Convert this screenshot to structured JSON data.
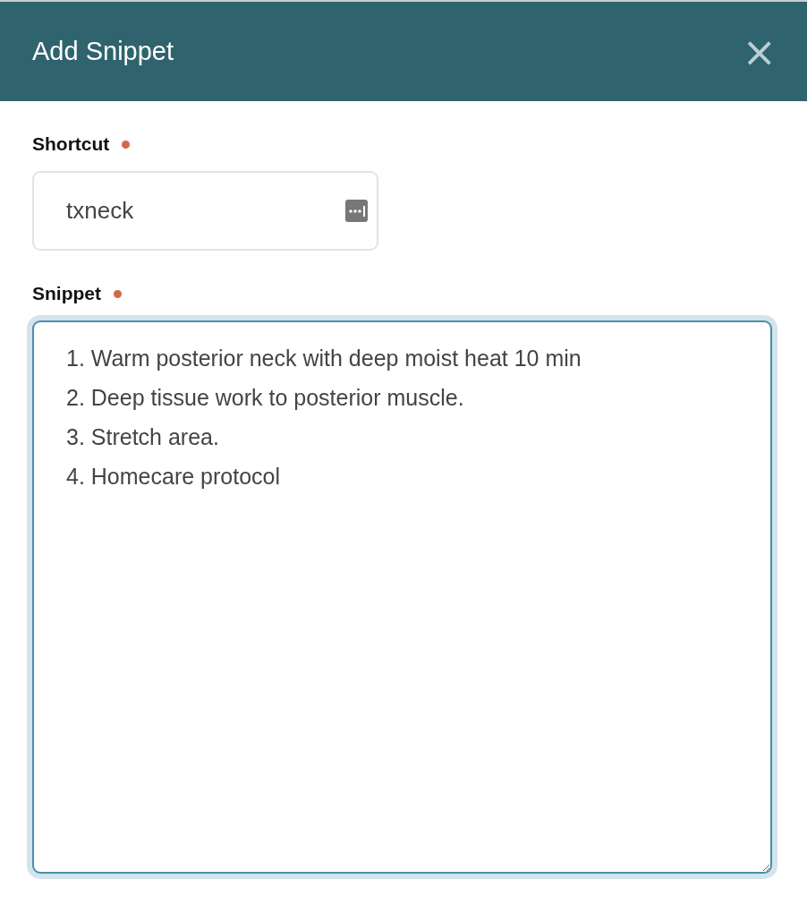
{
  "dialog": {
    "title": "Add Snippet",
    "close_label": "×"
  },
  "fields": [
    {
      "kind": "input",
      "label": "Shortcut",
      "required": true,
      "value": "txneck",
      "focused": false
    },
    {
      "kind": "textarea",
      "label": "Snippet",
      "required": true,
      "value": "1. Warm posterior neck with deep moist heat 10 min\n2. Deep tissue work to posterior muscle.\n3. Stretch area.\n4. Homecare protocol",
      "focused": true
    }
  ]
}
